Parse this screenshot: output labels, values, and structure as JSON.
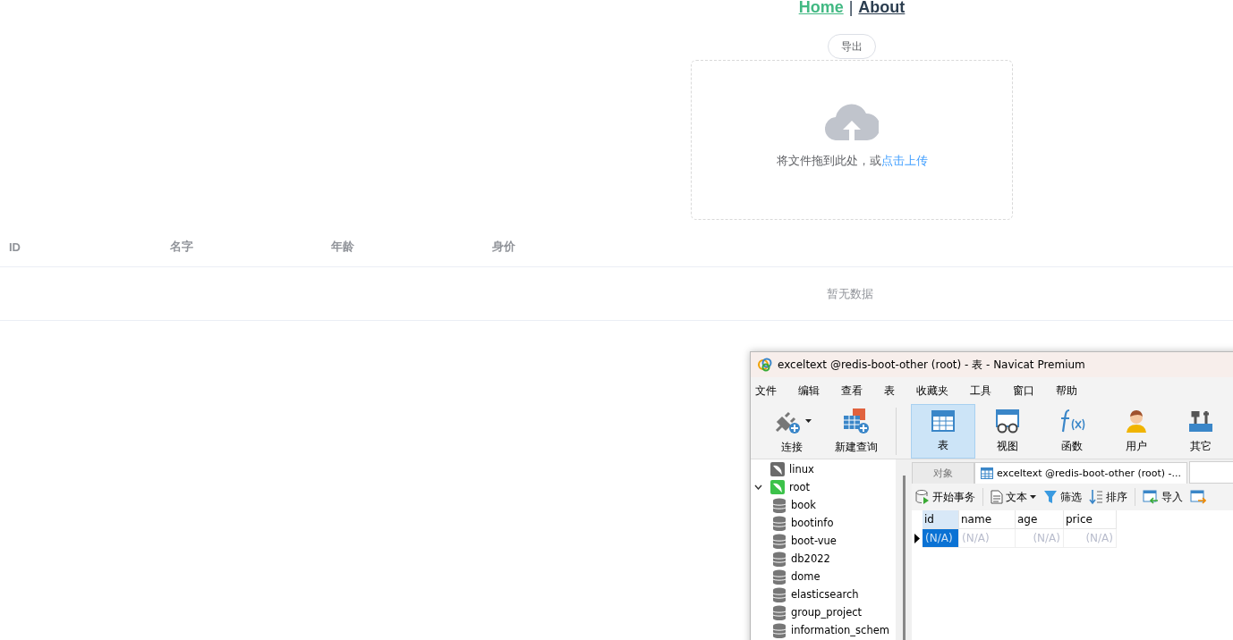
{
  "nav": {
    "links": [
      {
        "label": "Home",
        "selected": true
      },
      {
        "label": "About",
        "selected": false
      }
    ],
    "separator": "|"
  },
  "export_button": "导出",
  "upload": {
    "text": "将文件拖到此处，或",
    "link": "点击上传"
  },
  "table": {
    "columns": [
      "ID",
      "名字",
      "年龄",
      "身价"
    ],
    "empty_text": "暂无数据"
  },
  "navicat": {
    "title": "exceltext @redis-boot-other (root) - 表 - Navicat Premium",
    "menu": [
      "文件",
      "编辑",
      "查看",
      "表",
      "收藏夹",
      "工具",
      "窗口",
      "帮助"
    ],
    "toolbar": [
      {
        "kind": "connect",
        "label": "连接",
        "selected": false,
        "dropdown": true
      },
      {
        "kind": "query",
        "label": "新建查询",
        "selected": false,
        "dropdown": false
      },
      {
        "kind": "table",
        "label": "表",
        "selected": true,
        "dropdown": false
      },
      {
        "kind": "view",
        "label": "视图",
        "selected": false,
        "dropdown": false
      },
      {
        "kind": "function",
        "label": "函数",
        "selected": false,
        "dropdown": false
      },
      {
        "kind": "user",
        "label": "用户",
        "selected": false,
        "dropdown": false
      },
      {
        "kind": "other",
        "label": "其它",
        "selected": false,
        "dropdown": false
      }
    ],
    "tree": [
      {
        "label": "linux",
        "color": "#6b6b6b",
        "expanded": false
      },
      {
        "label": "root",
        "color": "#3cc24a",
        "expanded": true,
        "children": [
          {
            "label": "book"
          },
          {
            "label": "bootinfo"
          },
          {
            "label": "boot-vue"
          },
          {
            "label": "db2022"
          },
          {
            "label": "dome"
          },
          {
            "label": "elasticsearch"
          },
          {
            "label": "group_project"
          },
          {
            "label": "information_schem"
          }
        ]
      }
    ],
    "tabs": [
      {
        "kind": "objects",
        "label": "对象",
        "selected": false
      },
      {
        "kind": "table",
        "label": "exceltext @redis-boot-other (root) -...",
        "selected": true
      }
    ],
    "data_toolbar": [
      {
        "kind": "transaction",
        "label": "开始事务",
        "dropdown": false
      },
      {
        "kind": "text",
        "label": "文本",
        "dropdown": true
      },
      {
        "kind": "filter",
        "label": "筛选",
        "dropdown": false
      },
      {
        "kind": "sort",
        "label": "排序",
        "dropdown": false
      },
      {
        "kind": "import",
        "label": "导入",
        "dropdown": false
      }
    ],
    "grid": {
      "columns": [
        {
          "label": "id",
          "selected": true,
          "kind": "text"
        },
        {
          "label": "name",
          "selected": false,
          "kind": "text"
        },
        {
          "label": "age",
          "selected": false,
          "kind": "number"
        },
        {
          "label": "price",
          "selected": false,
          "kind": "number"
        }
      ],
      "rows": [
        {
          "current": true,
          "cells": [
            {
              "value": "(N/A)",
              "selected": true
            },
            {
              "value": "(N/A)",
              "selected": false
            },
            {
              "value": "(N/A)",
              "selected": false
            },
            {
              "value": "(N/A)",
              "selected": false
            }
          ]
        }
      ]
    }
  }
}
